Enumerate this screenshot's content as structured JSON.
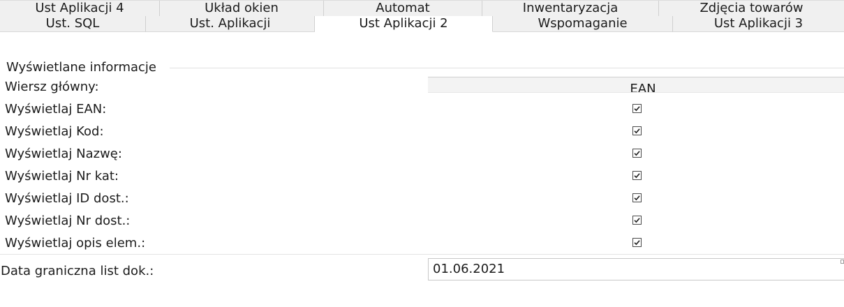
{
  "tabs": {
    "row1": [
      {
        "label": "Ust Aplikacji 4"
      },
      {
        "label": "Układ okien"
      },
      {
        "label": "Automat"
      },
      {
        "label": "Inwentaryzacja"
      },
      {
        "label": "Zdjęcia towarów"
      }
    ],
    "row2": [
      {
        "label": "Ust. SQL"
      },
      {
        "label": "Ust. Aplikacji"
      },
      {
        "label": "Ust Aplikacji 2",
        "active": true
      },
      {
        "label": "Wspomaganie"
      },
      {
        "label": "Ust Aplikacji 3"
      }
    ]
  },
  "group": {
    "title": "Wyświetlane informacje",
    "main_row_label": "Wiersz główny:",
    "main_row_value": "EAN",
    "options": [
      {
        "label": "Wyświetlaj EAN:",
        "checked": true
      },
      {
        "label": "Wyświetlaj Kod:",
        "checked": true
      },
      {
        "label": "Wyświetlaj Nazwę:",
        "checked": true
      },
      {
        "label": "Wyświetlaj Nr kat:",
        "checked": true
      },
      {
        "label": "Wyświetlaj ID dost.:",
        "checked": true
      },
      {
        "label": "Wyświetlaj Nr dost.:",
        "checked": true
      },
      {
        "label": "Wyświetlaj opis elem.:",
        "checked": true
      }
    ]
  },
  "date": {
    "label": "Data graniczna list dok.:",
    "value": "01.06.2021"
  },
  "icons": {
    "checkmark": "checkmark-icon",
    "calendar": "calendar-icon"
  }
}
